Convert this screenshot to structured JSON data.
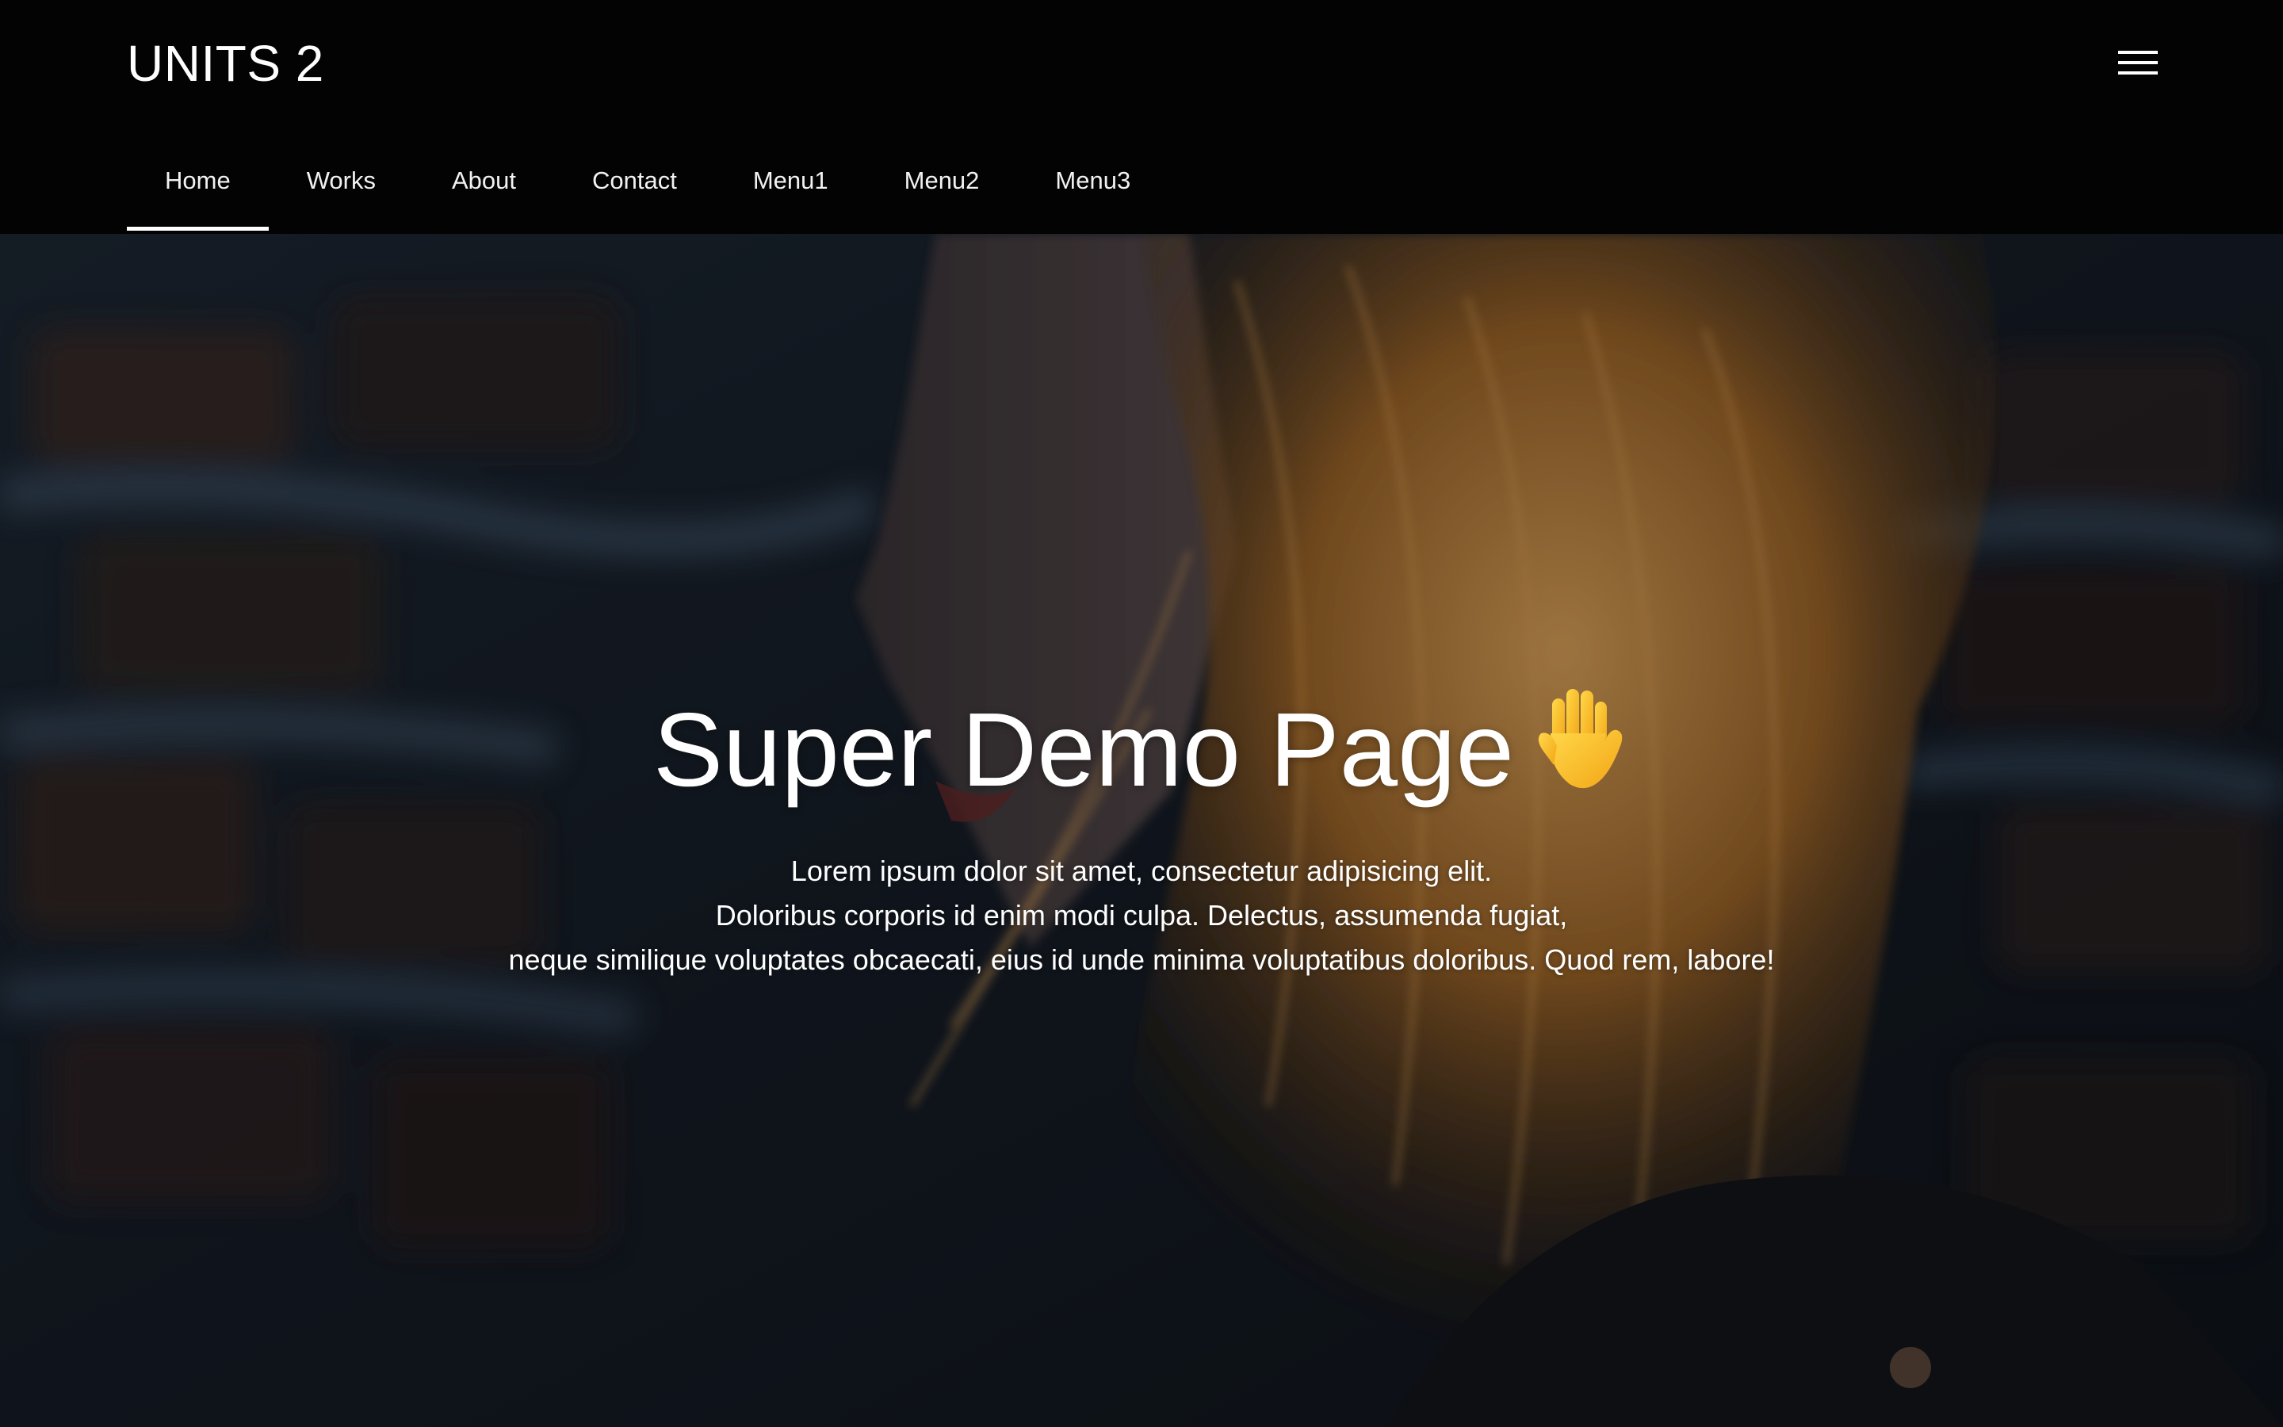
{
  "header": {
    "brand": "UNITS 2",
    "menu_icon": "hamburger-menu-icon"
  },
  "nav": {
    "items": [
      {
        "label": "Home",
        "active": true
      },
      {
        "label": "Works"
      },
      {
        "label": "About"
      },
      {
        "label": "Contact"
      },
      {
        "label": "Menu1"
      },
      {
        "label": "Menu2"
      },
      {
        "label": "Menu3"
      }
    ]
  },
  "hero": {
    "title": "Super Demo Page",
    "title_icon": "raised-hand-icon",
    "lines": [
      "Lorem ipsum dolor sit amet, consectetur adipisicing elit.",
      "Doloribus corporis id enim modi culpa. Delectus, assumenda fugiat,",
      "neque similique voluptates obcaecati, eius id unde minima voluptatibus doloribus. Quod rem, labore!"
    ]
  },
  "colors": {
    "header_bg": "#030303",
    "text": "#ffffff",
    "hair_accent": "#c98a3e",
    "wall_dark": "#1a2430"
  }
}
